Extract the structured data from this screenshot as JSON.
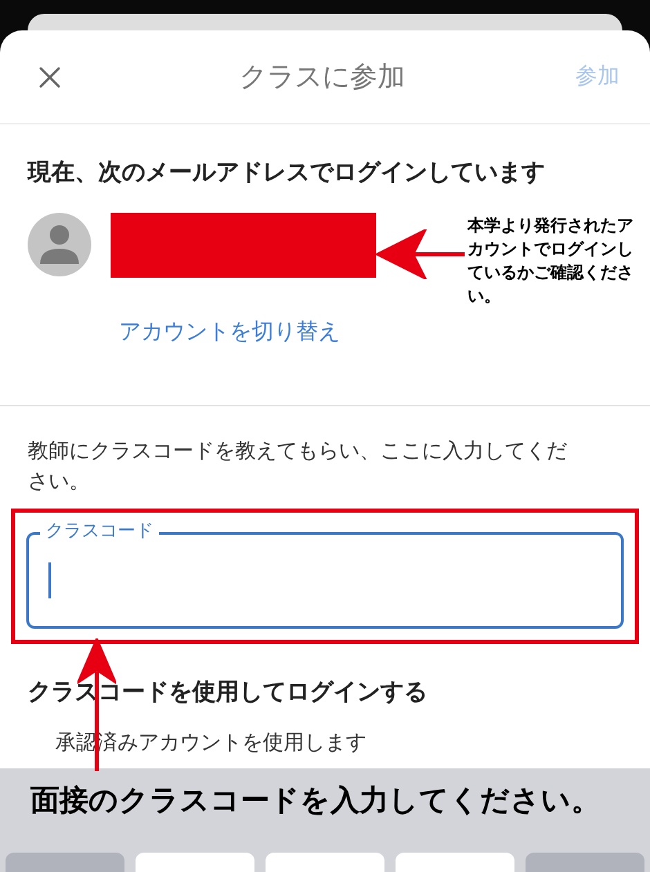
{
  "header": {
    "title": "クラスに参加",
    "action": "参加",
    "action_disabled": true
  },
  "account": {
    "heading": "現在、次のメールアドレスでログインしています",
    "switch_link": "アカウントを切り替え"
  },
  "class_code": {
    "instruction": "教師にクラスコードを教えてもらい、ここに入力してください。",
    "field_label": "クラスコード",
    "focused": true
  },
  "login_section": {
    "heading": "クラスコードを使用してログインする",
    "note": "承認済みアカウントを使用します"
  },
  "annotations": {
    "account_note": "本学より発行されたアカウントでログインしているかご確認ください。",
    "code_note": "面接のクラスコードを入力してください。"
  }
}
